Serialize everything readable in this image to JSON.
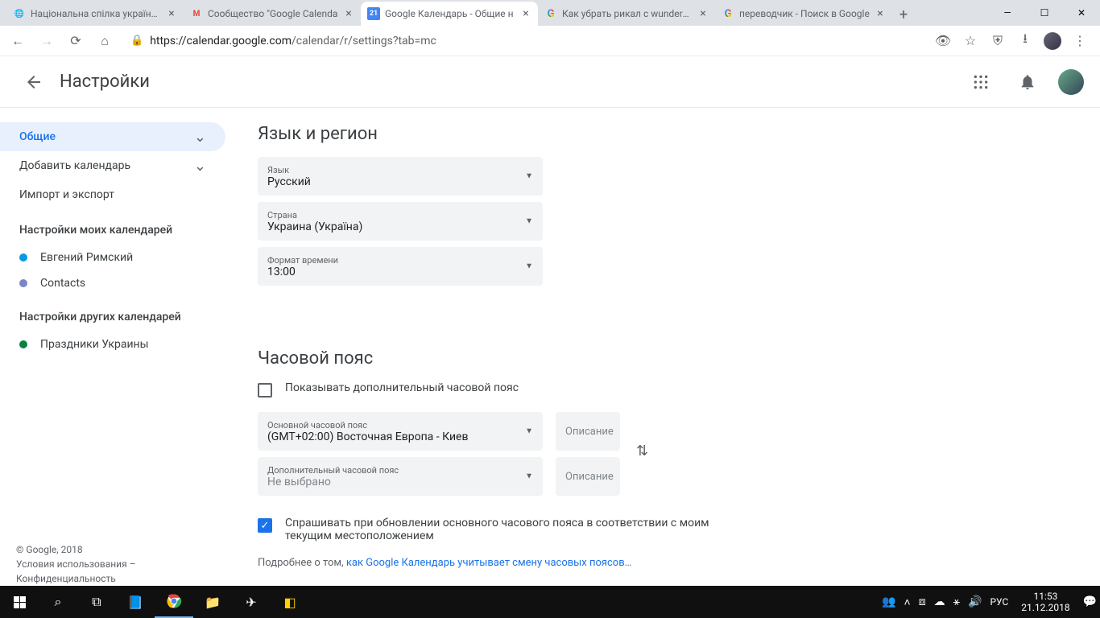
{
  "browser": {
    "tabs": [
      {
        "title": "Національна спілка українськ",
        "favicon": "🌐"
      },
      {
        "title": "Сообщество \"Google Calenda",
        "favicon": "M"
      },
      {
        "title": "Google Календарь - Общие н",
        "favicon": "21",
        "active": true
      },
      {
        "title": "Как убрать рикал с wundergro",
        "favicon": "G"
      },
      {
        "title": "переводчик - Поиск в Google",
        "favicon": "G"
      }
    ],
    "url_host": "https://calendar.google.com",
    "url_path": "/calendar/r/settings?tab=mc"
  },
  "header": {
    "title": "Настройки"
  },
  "sidebar": {
    "general": "Общие",
    "add_calendar": "Добавить календарь",
    "import_export": "Импорт и экспорт",
    "my_calendars_section": "Настройки моих календарей",
    "other_calendars_section": "Настройки других календарей",
    "my_calendars": [
      {
        "name": "Евгений Римский",
        "color": "#039be5"
      },
      {
        "name": "Contacts",
        "color": "#7986cb"
      }
    ],
    "other_calendars": [
      {
        "name": "Праздники Украины",
        "color": "#0b8043"
      }
    ]
  },
  "settings": {
    "lang_region": {
      "title": "Язык и регион",
      "language_label": "Язык",
      "language_value": "Русский",
      "country_label": "Страна",
      "country_value": "Украина (Україна)",
      "time_format_label": "Формат времени",
      "time_format_value": "13:00"
    },
    "timezone": {
      "title": "Часовой пояс",
      "show_secondary": "Показывать дополнительный часовой пояс",
      "primary_label": "Основной часовой пояс",
      "primary_value": "(GMT+02:00) Восточная Европа - Киев",
      "secondary_label": "Дополнительный часовой пояс",
      "secondary_value": "Не выбрано",
      "desc_placeholder": "Описание",
      "ask_update": "Спрашивать при обновлении основного часового пояса в соответствии с моим текущим местоположением",
      "learn_more_prefix": "Подробнее о том, ",
      "learn_more_link": "как Google Календарь учитывает смену часовых поясов…"
    }
  },
  "footer": {
    "copyright": "© Google, 2018",
    "terms": "Условия использования",
    "privacy": "Конфиденциальность"
  },
  "taskbar": {
    "lang": "РУС",
    "time": "11:53",
    "date": "21.12.2018"
  }
}
